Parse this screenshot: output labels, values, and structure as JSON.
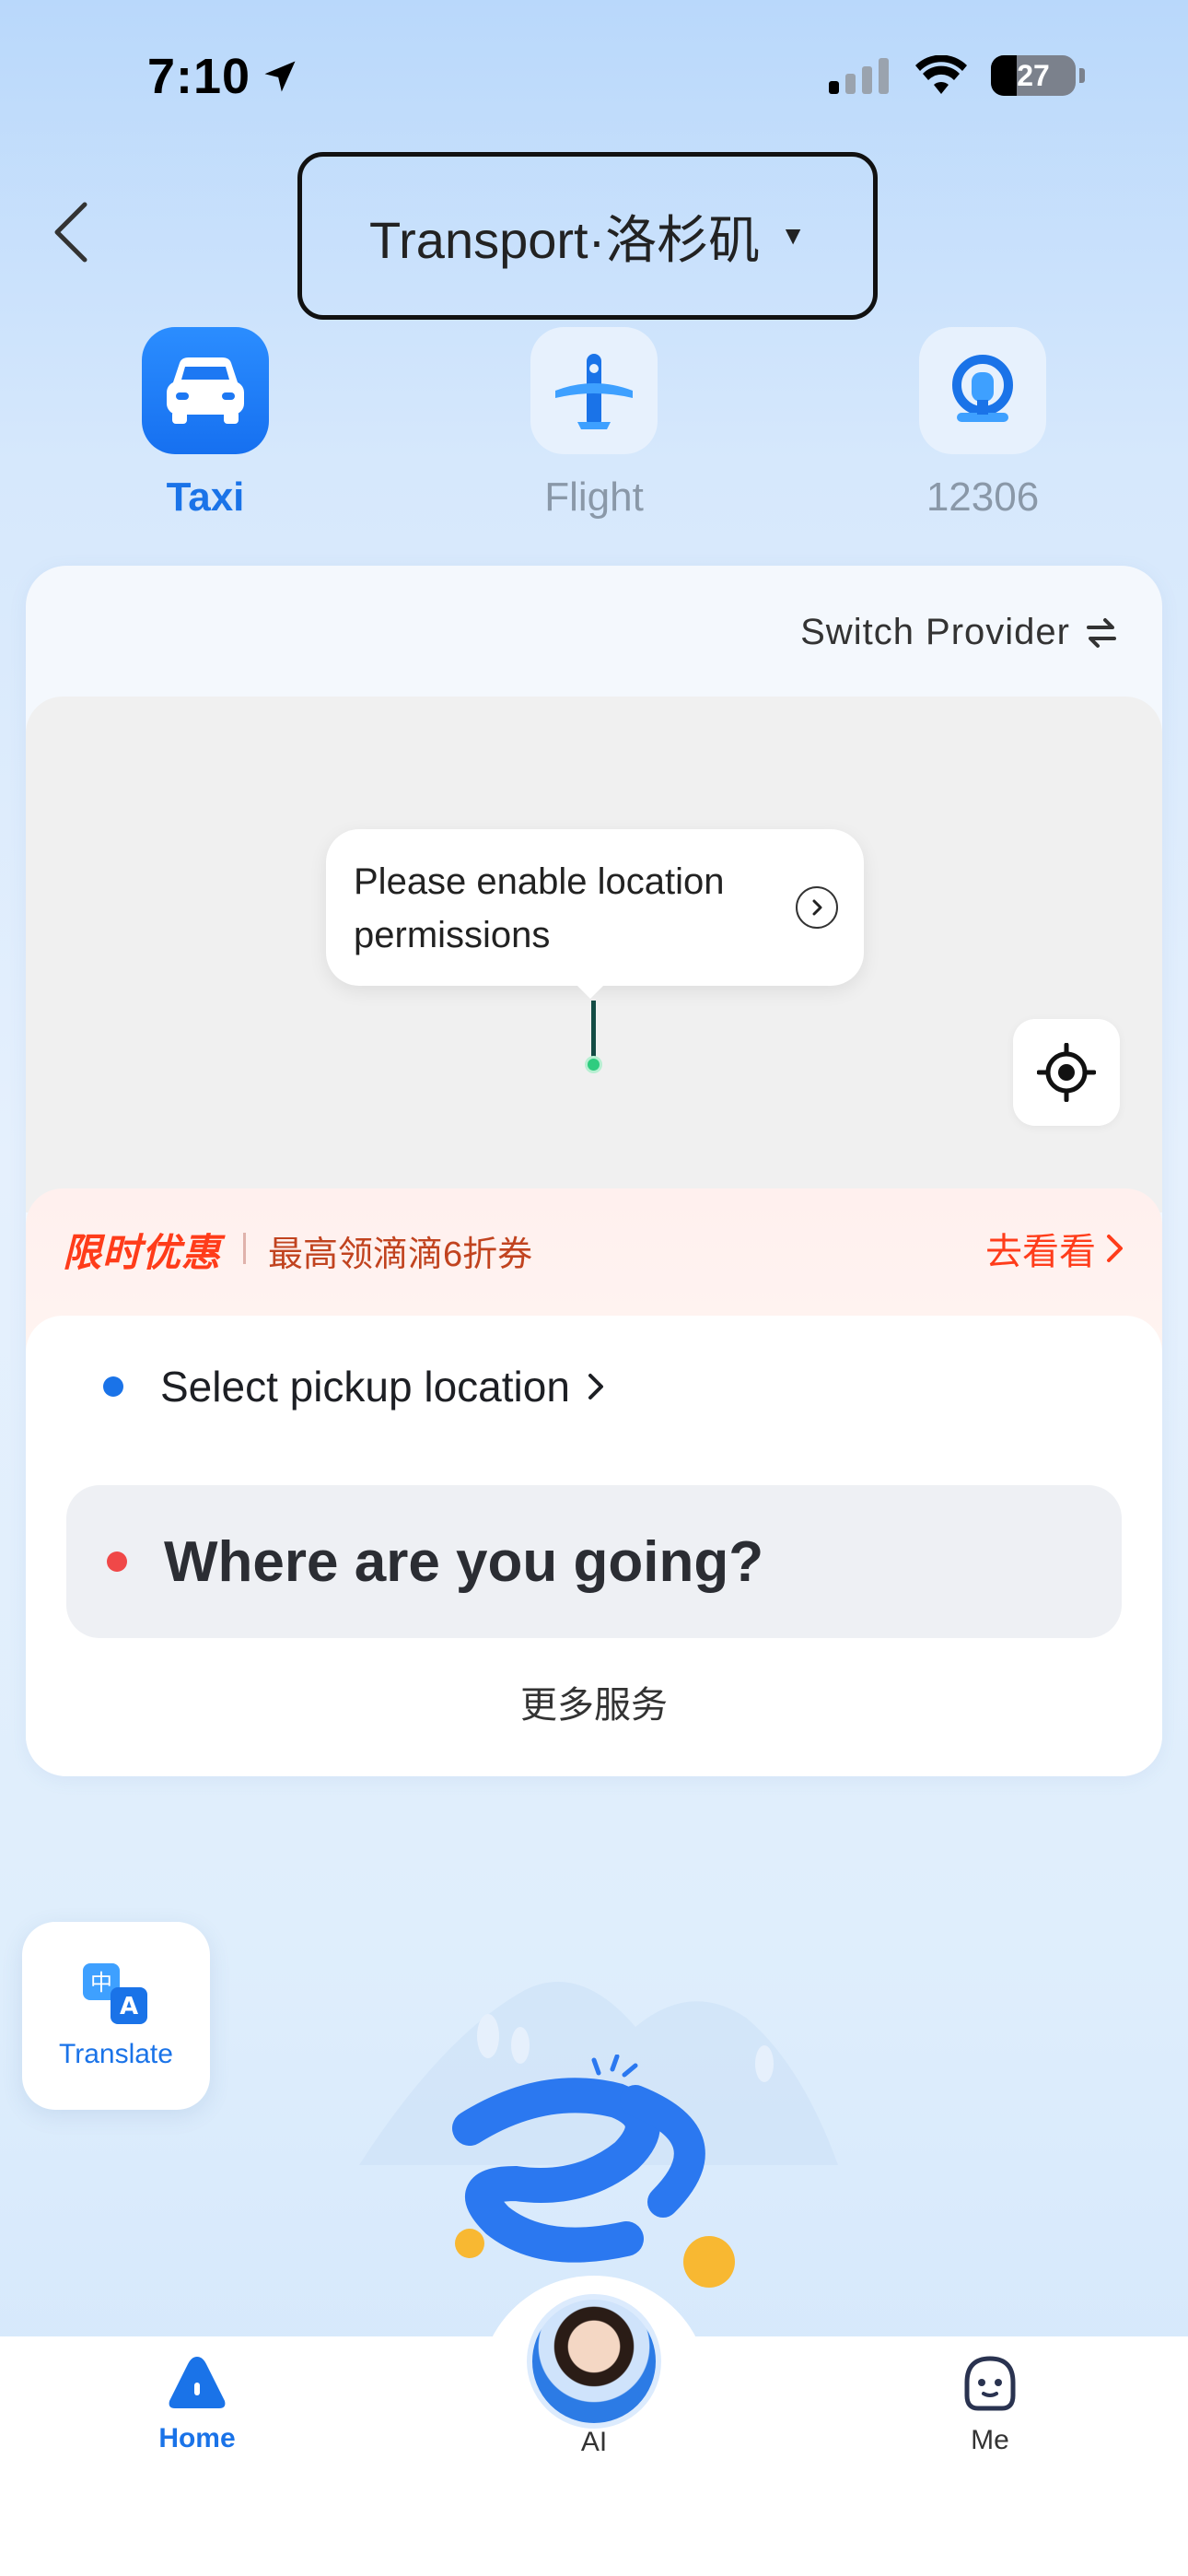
{
  "status_bar": {
    "time": "7:10",
    "battery": "27"
  },
  "header": {
    "title": "Transport·洛杉矶"
  },
  "categories": [
    {
      "label": "Taxi"
    },
    {
      "label": "Flight"
    },
    {
      "label": "12306"
    }
  ],
  "card": {
    "switch_provider": "Switch Provider",
    "tooltip": "Please enable location permissions",
    "promo": {
      "tag": "限时优惠",
      "text": "最高领滴滴6折券",
      "link": "去看看"
    },
    "pickup": "Select pickup location",
    "destination": "Where are you going?",
    "more_services": "更多服务"
  },
  "translate": {
    "label": "Translate"
  },
  "tabbar": {
    "home": "Home",
    "ai": "AI",
    "me": "Me"
  },
  "colors": {
    "accent": "#1a73e8",
    "promo": "#ff3c1a",
    "pickup_dot": "#1a73e8",
    "dest_dot": "#f04848"
  }
}
